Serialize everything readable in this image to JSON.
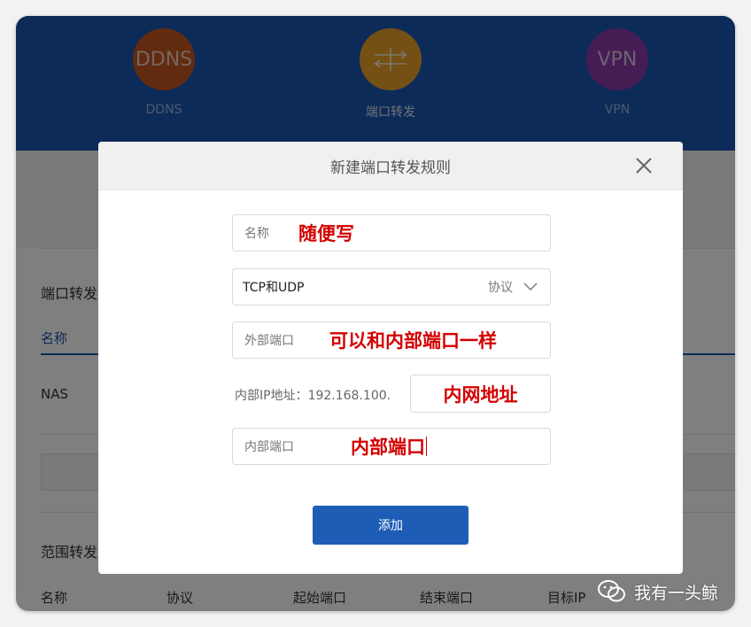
{
  "nav": {
    "items": [
      {
        "circle": "DDNS",
        "label": "DDNS",
        "color": "#c4551e"
      },
      {
        "circle": "",
        "label": "端口转发",
        "color": "#e8a02a"
      },
      {
        "circle": "VPN",
        "label": "VPN",
        "color": "#8a3aa8"
      }
    ]
  },
  "background": {
    "section1_title": "端口转发",
    "col_name": "名称",
    "row_name": "NAS",
    "section2_title": "范围转发",
    "table2_headers": [
      "名称",
      "协议",
      "起始端口",
      "结束端口",
      "目标IP"
    ]
  },
  "modal": {
    "title": "新建端口转发规则",
    "name_placeholder": "名称",
    "name_annotation": "随便写",
    "protocol_value": "TCP和UDP",
    "protocol_label": "协议",
    "ext_port_placeholder": "外部端口",
    "ext_port_annotation": "可以和内部端口一样",
    "ip_label": "内部IP地址：192.168.100.",
    "ip_annotation": "内网地址",
    "int_port_placeholder": "内部端口",
    "int_port_annotation": "内部端口",
    "add_label": "添加"
  },
  "watermark": {
    "text": "我有一头鲸"
  },
  "colors": {
    "brand_blue": "#1b56b0",
    "button_blue": "#1d5db5",
    "annotation_red": "#d40000"
  }
}
